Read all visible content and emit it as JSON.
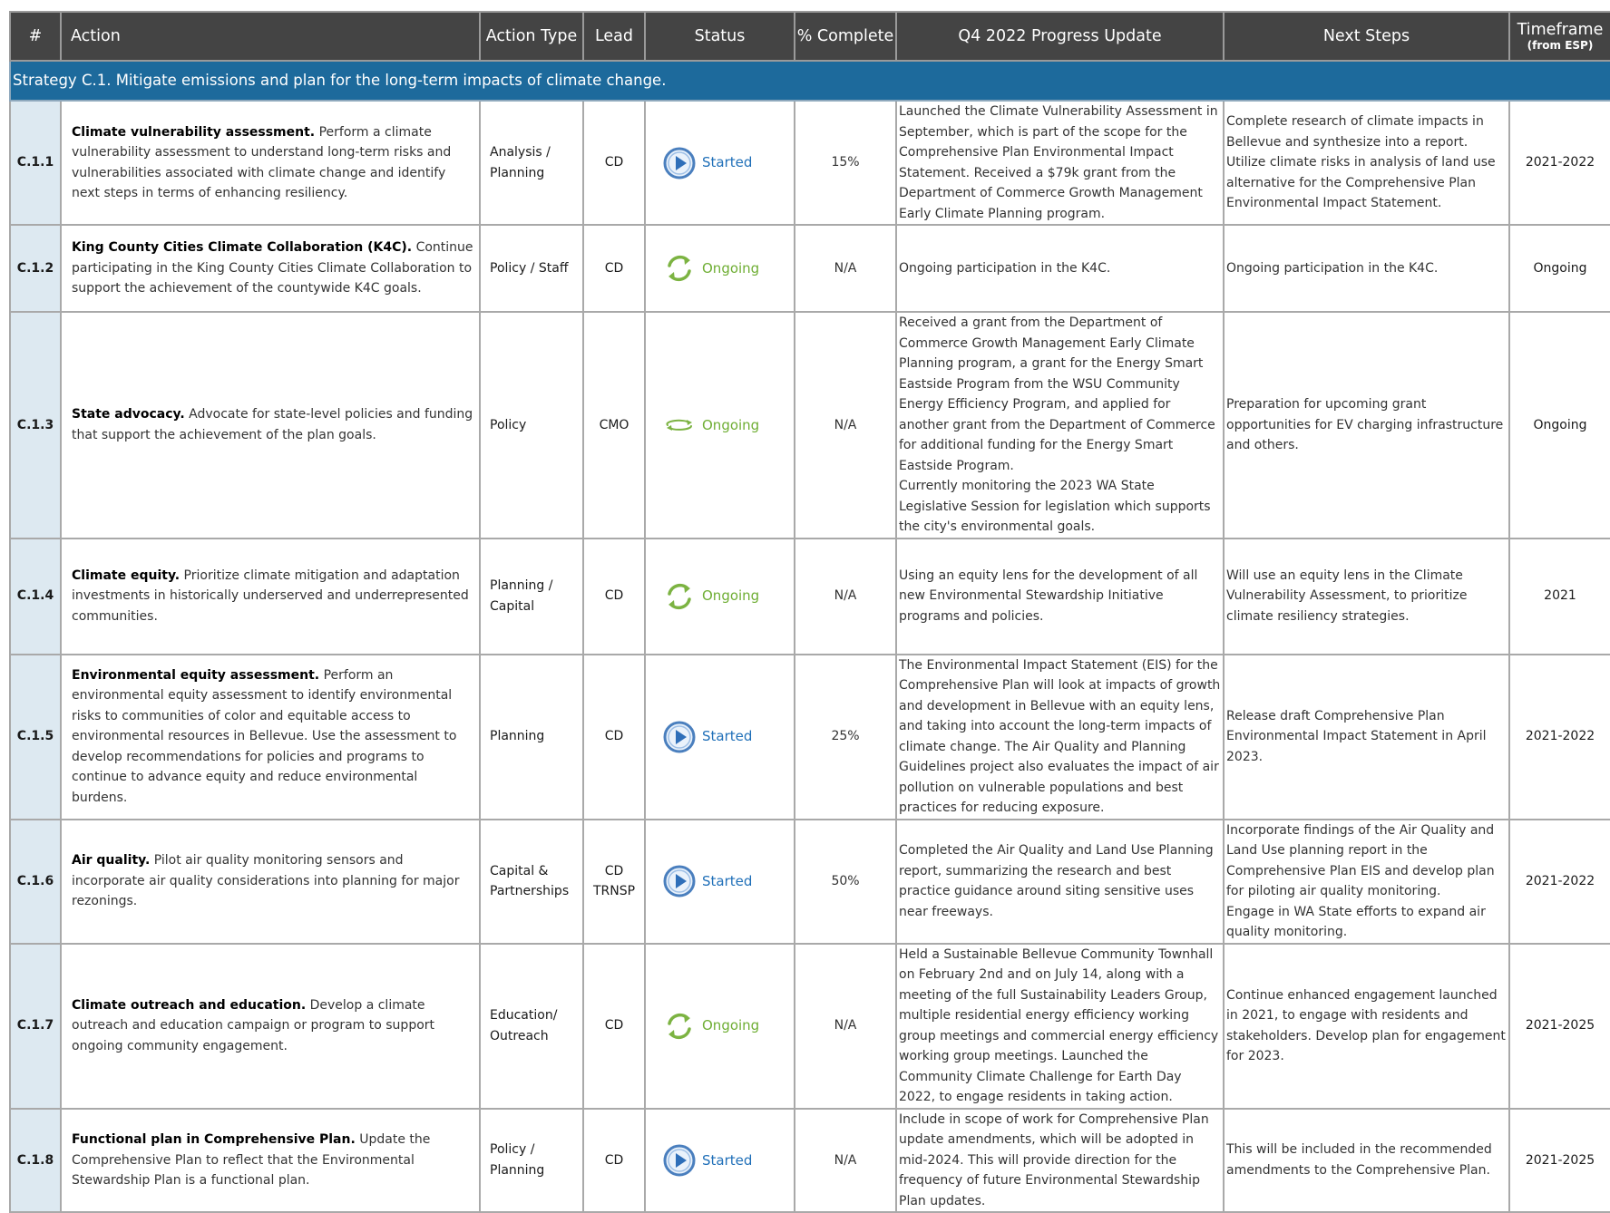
{
  "header": {
    "num": "#",
    "action": "Action",
    "action_type": "Action Type",
    "lead": "Lead",
    "status": "Status",
    "pct": "% Complete",
    "progress": "Q4 2022 Progress Update",
    "next": "Next Steps",
    "timeframe": "Timeframe",
    "timeframe_sub": "(from ESP)"
  },
  "strategy": "Strategy C.1. Mitigate emissions and plan for the long-term impacts of climate change.",
  "colors": {
    "header_bg": "#444444",
    "strategy_bg": "#1d6a9c",
    "num_bg": "#dde9f1",
    "started": "#1f6fb8",
    "ongoing": "#6fae34"
  },
  "rows": [
    {
      "id": "C.1.1",
      "title": "Climate vulnerability assessment.",
      "desc": " Perform a climate vulnerability assessment to understand long-term risks and vulnerabilities associated with climate change and identify next steps in terms of enhancing resiliency.",
      "action_type": "Analysis / Planning",
      "lead": "CD",
      "status": "Started",
      "status_icon": "play-circle-icon",
      "pct": "15%",
      "progress": "Launched the Climate Vulnerability Assessment in September, which is part of the scope for the Comprehensive Plan Environmental Impact Statement. Received a $79k grant from the Department of Commerce Growth Management Early Climate Planning program.",
      "next": "Complete research of climate impacts in Bellevue and synthesize into a report. Utilize climate risks in analysis of land use alternative for the Comprehensive Plan Environmental Impact Statement.",
      "timeframe": "2021-2022"
    },
    {
      "id": "C.1.2",
      "title": "King County Cities Climate Collaboration (K4C).",
      "desc": " Continue participating in the King County Cities Climate Collaboration to support the achievement of the countywide K4C goals.",
      "action_type": "Policy / Staff",
      "lead": "CD",
      "status": "Ongoing",
      "status_icon": "recycle-arrows-icon",
      "pct": "N/A",
      "progress": "Ongoing participation in the K4C.",
      "next": "Ongoing participation in the K4C.",
      "timeframe": "Ongoing"
    },
    {
      "id": "C.1.3",
      "title": "State advocacy.",
      "desc": " Advocate for state-level policies and funding that support the achievement of the plan goals.",
      "action_type": "Policy",
      "lead": "CMO",
      "status": "Ongoing",
      "status_icon": "recycle-arrows-icon",
      "pct": "N/A",
      "progress": "Received a grant from the Department of Commerce Growth Management Early Climate Planning program, a grant for the Energy Smart Eastside Program from the WSU Community Energy Efficiency Program, and applied for another grant from the Department of Commerce for additional funding for the Energy Smart Eastside Program.",
      "progress2": "Currently monitoring the 2023 WA State Legislative Session for legislation which supports the city's environmental goals.",
      "next": "Preparation for upcoming grant opportunities for EV charging infrastructure and others.",
      "timeframe": "Ongoing"
    },
    {
      "id": "C.1.4",
      "title": "Climate equity.",
      "desc": " Prioritize climate mitigation and adaptation investments in historically underserved and underrepresented communities.",
      "action_type": "Planning / Capital",
      "lead": "CD",
      "status": "Ongoing",
      "status_icon": "recycle-arrows-icon",
      "pct": "N/A",
      "progress": "Using an equity lens for the development of all new Environmental Stewardship Initiative programs and policies.",
      "next": "Will use an equity lens in the Climate Vulnerability Assessment, to prioritize climate resiliency strategies.",
      "timeframe": "2021"
    },
    {
      "id": "C.1.5",
      "title": "Environmental equity assessment.",
      "desc": " Perform an environmental equity assessment to identify environmental risks to communities of color and equitable access to environmental resources in Bellevue. Use the assessment to develop recommendations for policies and programs to continue to advance equity and reduce environmental burdens.",
      "action_type": "Planning",
      "lead": "CD",
      "status": "Started",
      "status_icon": "play-circle-icon",
      "pct": "25%",
      "progress": "The Environmental Impact Statement (EIS) for the Comprehensive Plan will look at impacts of growth and development in Bellevue with an equity lens, and taking into account the long-term impacts of climate change. The Air Quality and Planning Guidelines project also evaluates the impact of air pollution on vulnerable populations and best practices for reducing exposure.",
      "next": "Release draft Comprehensive Plan Environmental Impact Statement in April 2023.",
      "timeframe": "2021-2022"
    },
    {
      "id": "C.1.6",
      "title": "Air quality.",
      "desc": " Pilot air quality monitoring sensors and incorporate air quality considerations into planning for major rezonings.",
      "action_type": "Capital & Partnerships",
      "lead": "CD",
      "lead2": "TRNSP",
      "status": "Started",
      "status_icon": "play-circle-icon",
      "pct": "50%",
      "progress": "Completed the Air Quality and Land Use Planning report, summarizing the research and best practice guidance around siting sensitive uses near freeways.",
      "next": "Incorporate findings of the Air Quality and Land Use planning report in the Comprehensive Plan EIS and develop plan for piloting air quality monitoring.",
      "next2": "Engage in WA State efforts to expand air quality monitoring.",
      "timeframe": "2021-2022"
    },
    {
      "id": "C.1.7",
      "title": "Climate outreach and education.",
      "desc": " Develop a climate outreach and education campaign or program to support ongoing community engagement.",
      "action_type": "Education/ Outreach",
      "lead": "CD",
      "status": "Ongoing",
      "status_icon": "recycle-arrows-icon",
      "pct": "N/A",
      "progress": "Held a Sustainable Bellevue Community Townhall on February 2nd and on July 14, along with a meeting of the full Sustainability Leaders Group, multiple residential energy efficiency working group meetings and commercial energy efficiency working group meetings. Launched the Community Climate Challenge for Earth Day 2022, to engage residents in taking action.",
      "next": "Continue enhanced engagement launched in 2021, to engage with residents and stakeholders. Develop plan for engagement for 2023.",
      "timeframe": "2021-2025"
    },
    {
      "id": "C.1.8",
      "title": "Functional plan in Comprehensive Plan.",
      "desc": " Update the Comprehensive Plan to reflect that the Environmental Stewardship Plan is a functional plan.",
      "action_type": "Policy / Planning",
      "lead": "CD",
      "status": "Started",
      "status_icon": "play-circle-icon",
      "pct": "N/A",
      "progress": "Include in scope of work for Comprehensive Plan update amendments, which will be adopted in mid-2024. This will provide direction for the frequency of future Environmental Stewardship Plan updates.",
      "next": "This will be included in the recommended amendments to the Comprehensive Plan.",
      "timeframe": "2021-2025"
    }
  ]
}
